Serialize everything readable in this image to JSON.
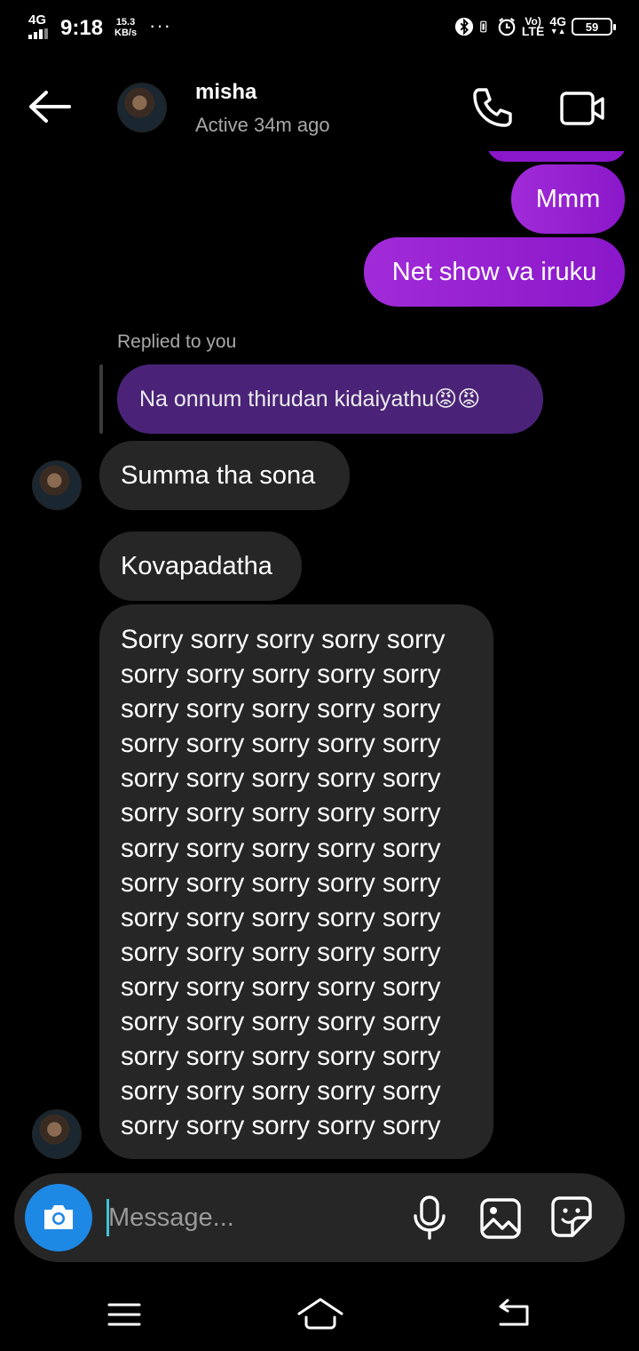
{
  "status_bar": {
    "network": "4G",
    "time": "9:18",
    "speed_value": "15.3",
    "speed_unit": "KB/s",
    "more": "···",
    "volte": "Vo)",
    "lte": "LTE",
    "network_right": "4G",
    "battery": "59"
  },
  "header": {
    "name": "misha",
    "status": "Active 34m ago",
    "icons": [
      "back-arrow-icon",
      "phone-icon",
      "video-camera-icon"
    ]
  },
  "messages": {
    "sent": [
      {
        "text": "Mmm"
      },
      {
        "text": "Net show va iruku"
      }
    ],
    "reply_label": "Replied to you",
    "reply_quote": "Na onnum thirudan kidaiyathu😡😡",
    "received": [
      {
        "text": "Summa tha sona"
      },
      {
        "text": "Kovapadatha"
      }
    ],
    "long_message": "Sorry sorry sorry sorry sorry sorry sorry sorry sorry sorry sorry sorry sorry sorry sorry sorry sorry sorry sorry sorry sorry sorry sorry sorry sorry sorry sorry sorry sorry sorry sorry sorry sorry sorry sorry sorry sorry sorry sorry sorry sorry sorry sorry sorry sorry sorry sorry sorry sorry sorry sorry sorry sorry sorry sorry sorry sorry sorry sorry sorry sorry sorry sorry sorry sorry sorry sorry sorry sorry sorry sorry sorry sorry sorry sorry"
  },
  "composer": {
    "placeholder": "Message...",
    "icons": [
      "camera-icon",
      "microphone-icon",
      "gallery-icon",
      "sticker-icon"
    ]
  },
  "colors": {
    "sent_bubble": "#9b24d6",
    "received_bubble": "#262626",
    "reply_bubble": "#4a2378",
    "camera_button": "#1e88e5",
    "background": "#000000"
  }
}
